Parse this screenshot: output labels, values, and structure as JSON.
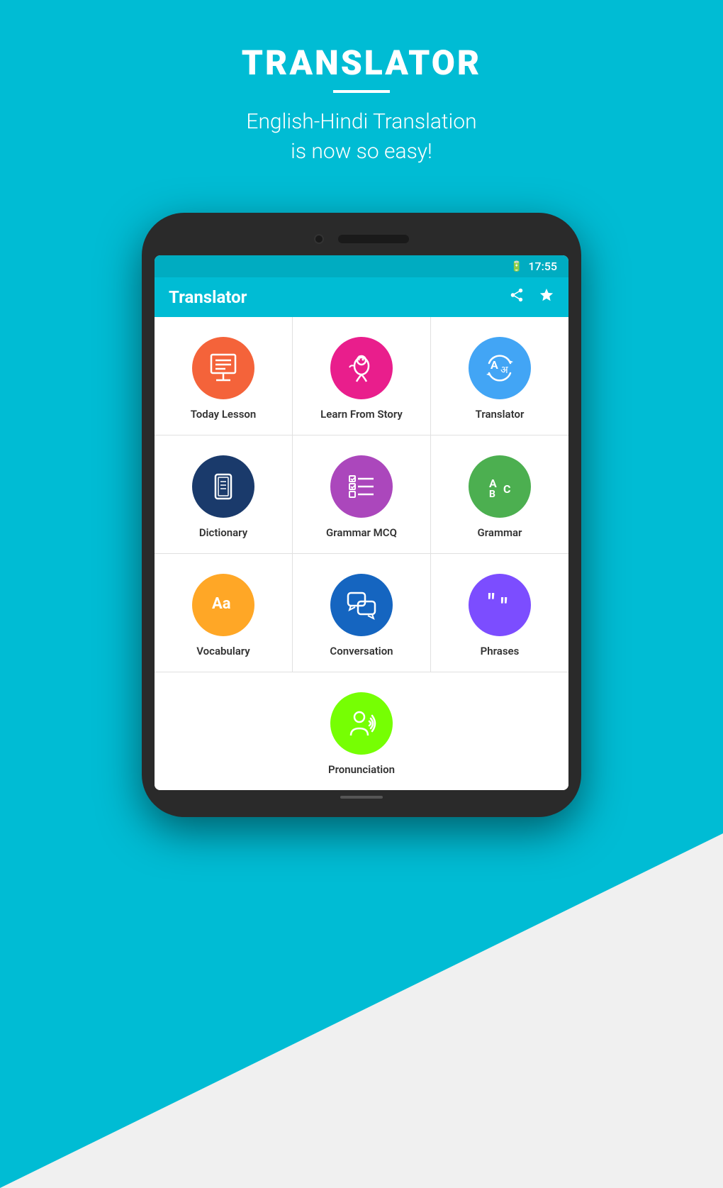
{
  "background": {
    "top_color": "#00BCD4",
    "bottom_color": "#f0f0f0"
  },
  "header": {
    "title": "TRANSLATOR",
    "subtitle_line1": "English-Hindi Translation",
    "subtitle_line2": "is now so easy!"
  },
  "phone": {
    "status_bar": {
      "time": "17:55",
      "battery_icon": "🔋"
    },
    "app_bar": {
      "title": "Translator",
      "share_icon": "share",
      "star_icon": "star"
    },
    "grid_items": [
      {
        "label": "Today Lesson",
        "circle_color": "#F4633A",
        "icon": "lesson"
      },
      {
        "label": "Learn From Story",
        "circle_color": "#E91E8C",
        "icon": "story"
      },
      {
        "label": "Translator",
        "circle_color": "#42A5F5",
        "icon": "translator"
      },
      {
        "label": "Dictionary",
        "circle_color": "#1A3A6B",
        "icon": "dictionary"
      },
      {
        "label": "Grammar MCQ",
        "circle_color": "#AB47BC",
        "icon": "grammar_mcq"
      },
      {
        "label": "Grammar",
        "circle_color": "#4CAF50",
        "icon": "grammar"
      },
      {
        "label": "Vocabulary",
        "circle_color": "#FFA726",
        "icon": "vocabulary"
      },
      {
        "label": "Conversation",
        "circle_color": "#1565C0",
        "icon": "conversation"
      },
      {
        "label": "Phrases",
        "circle_color": "#7C4DFF",
        "icon": "phrases"
      }
    ],
    "bottom_item": {
      "label": "Pronunciation",
      "circle_color": "#76FF03",
      "icon": "pronunciation"
    }
  }
}
